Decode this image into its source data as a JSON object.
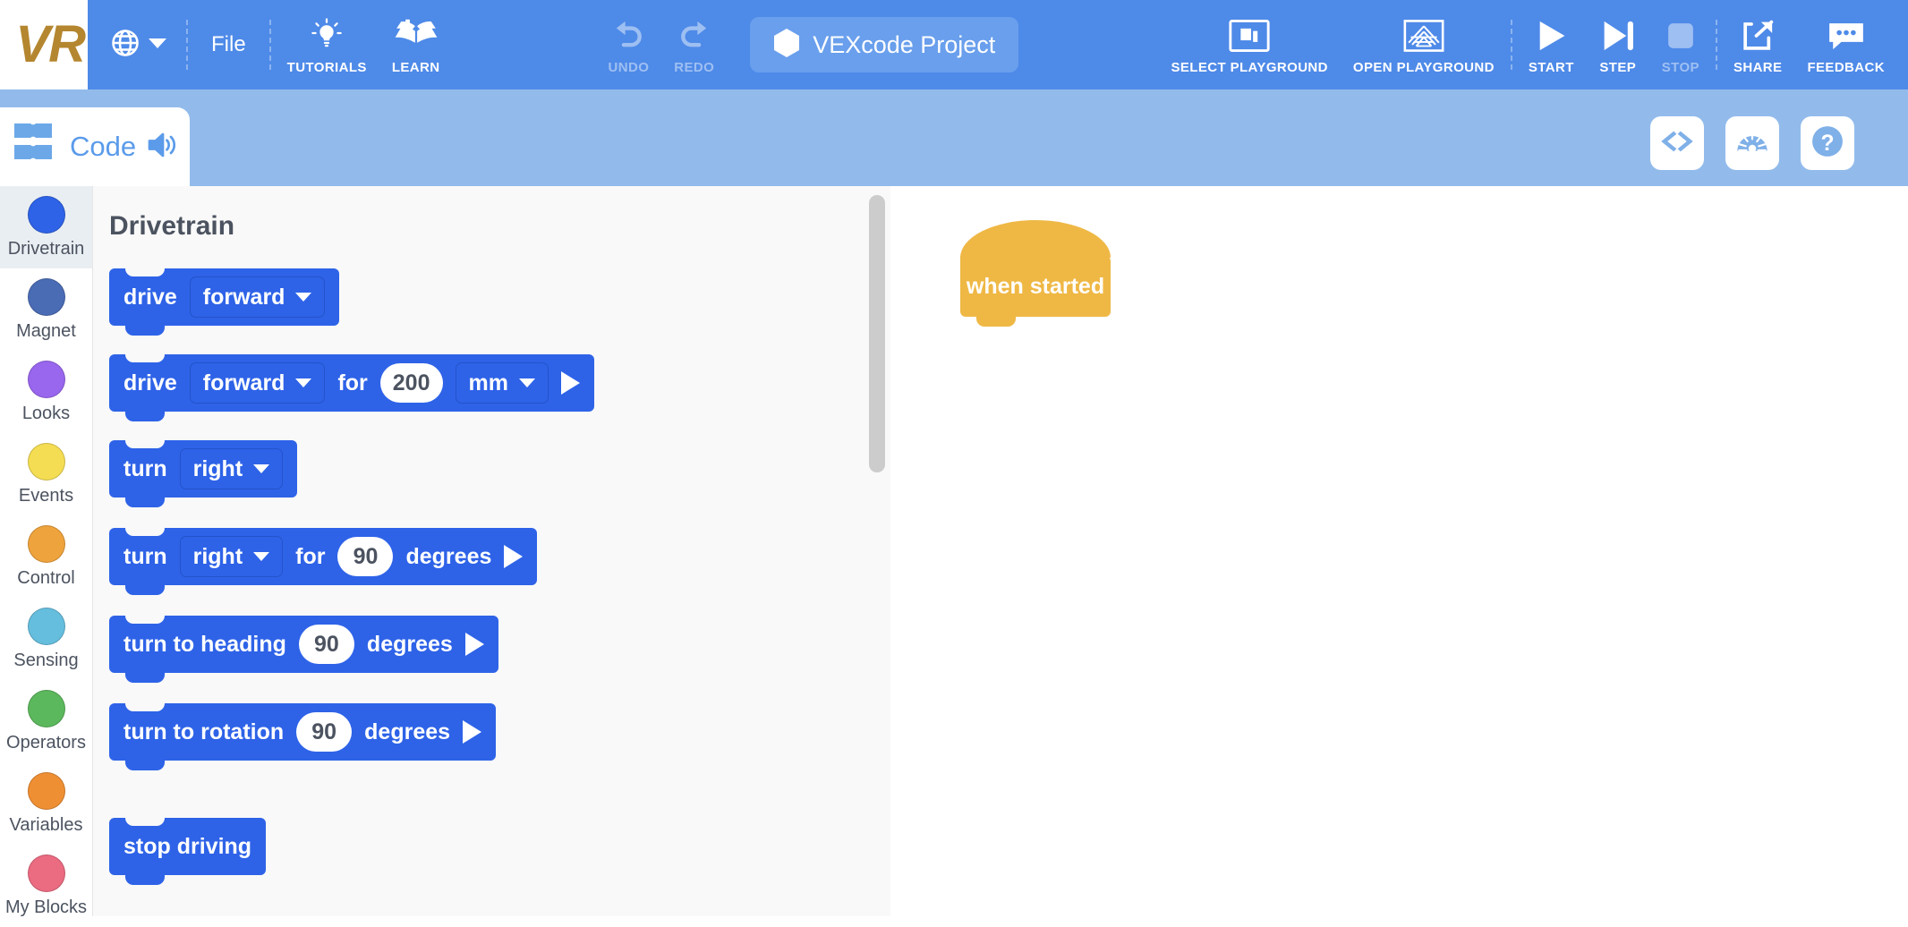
{
  "app": {
    "logo": "VR",
    "project_name": "VEXcode Project",
    "accent_blue": "#4e8ae8",
    "subbar_blue": "#92bbeb",
    "block_blue": "#2e63e8",
    "hat_yellow": "#efb845",
    "logo_gold": "#b4862f"
  },
  "toolbar": {
    "language_icon": "globe-icon",
    "file_label": "File",
    "tutorials_label": "TUTORIALS",
    "tutorials_icon": "lightbulb-icon",
    "learn_label": "LEARN",
    "learn_icon": "open-book-icon",
    "undo_label": "UNDO",
    "undo_icon": "undo-arrow-icon",
    "redo_label": "REDO",
    "redo_icon": "redo-arrow-icon",
    "project_icon": "hexagon-icon",
    "select_playground_label": "SELECT PLAYGROUND",
    "select_playground_icon": "windows-stack-icon",
    "open_playground_label": "OPEN PLAYGROUND",
    "open_playground_icon": "field-grid-icon",
    "start_label": "START",
    "start_icon": "play-icon",
    "step_label": "STEP",
    "step_icon": "step-forward-icon",
    "stop_label": "STOP",
    "stop_icon": "stop-square-icon",
    "share_label": "SHARE",
    "share_icon": "share-export-icon",
    "feedback_label": "FEEDBACK",
    "feedback_icon": "speech-bubble-icon"
  },
  "subbar": {
    "code_tab_label": "Code",
    "code_tab_icon": "blocks-icon",
    "speaker_icon": "speaker-icon",
    "buttons": [
      {
        "name": "view-code-button",
        "icon": "angle-brackets-icon"
      },
      {
        "name": "dashboard-button",
        "icon": "gauge-icon"
      },
      {
        "name": "help-button",
        "icon": "question-mark-icon"
      }
    ]
  },
  "categories": [
    {
      "label": "Drivetrain",
      "color": "#2e63e8",
      "selected": true
    },
    {
      "label": "Magnet",
      "color": "#4a6cb5",
      "selected": false
    },
    {
      "label": "Looks",
      "color": "#9966ee",
      "selected": false
    },
    {
      "label": "Events",
      "color": "#f5dd53",
      "selected": false
    },
    {
      "label": "Control",
      "color": "#efa33c",
      "selected": false
    },
    {
      "label": "Sensing",
      "color": "#66bede",
      "selected": false
    },
    {
      "label": "Operators",
      "color": "#5cb85c",
      "selected": false
    },
    {
      "label": "Variables",
      "color": "#ef8f33",
      "selected": false
    },
    {
      "label": "My Blocks",
      "color": "#eb6b81",
      "selected": false
    }
  ],
  "palette": {
    "title": "Drivetrain",
    "blocks": [
      {
        "name": "drive-direction-block",
        "parts": [
          {
            "type": "label",
            "text": "drive"
          },
          {
            "type": "dropdown",
            "text": "forward"
          }
        ]
      },
      {
        "name": "drive-for-distance-block",
        "parts": [
          {
            "type": "label",
            "text": "drive"
          },
          {
            "type": "dropdown",
            "text": "forward"
          },
          {
            "type": "label",
            "text": "for"
          },
          {
            "type": "number",
            "text": "200"
          },
          {
            "type": "dropdown",
            "text": "mm"
          },
          {
            "type": "play",
            "text": ""
          }
        ]
      },
      {
        "name": "turn-direction-block",
        "parts": [
          {
            "type": "label",
            "text": "turn"
          },
          {
            "type": "dropdown",
            "text": "right"
          }
        ]
      },
      {
        "name": "turn-for-degrees-block",
        "parts": [
          {
            "type": "label",
            "text": "turn"
          },
          {
            "type": "dropdown",
            "text": "right"
          },
          {
            "type": "label",
            "text": "for"
          },
          {
            "type": "number",
            "text": "90"
          },
          {
            "type": "label",
            "text": "degrees"
          },
          {
            "type": "play",
            "text": ""
          }
        ]
      },
      {
        "name": "turn-to-heading-block",
        "parts": [
          {
            "type": "label",
            "text": "turn to heading"
          },
          {
            "type": "number",
            "text": "90"
          },
          {
            "type": "label",
            "text": "degrees"
          },
          {
            "type": "play",
            "text": ""
          }
        ]
      },
      {
        "name": "turn-to-rotation-block",
        "parts": [
          {
            "type": "label",
            "text": "turn to rotation"
          },
          {
            "type": "number",
            "text": "90"
          },
          {
            "type": "label",
            "text": "degrees"
          },
          {
            "type": "play",
            "text": ""
          }
        ]
      },
      {
        "name": "stop-driving-block",
        "parts": [
          {
            "type": "label",
            "text": "stop driving"
          }
        ]
      }
    ]
  },
  "workspace": {
    "blocks": [
      {
        "name": "when-started-hat-block",
        "text": "when started"
      }
    ]
  }
}
